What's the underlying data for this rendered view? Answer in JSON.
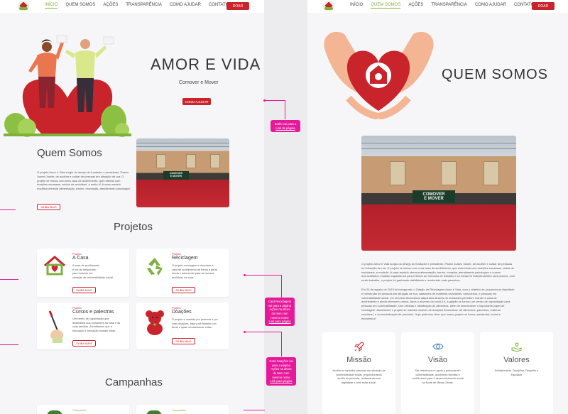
{
  "nav": {
    "items": [
      "INÍCIO",
      "QUEM SOMOS",
      "AÇÕES",
      "TRANSPARÊNCIA",
      "COMO AJUDAR",
      "CONTATO"
    ],
    "donate_label": "DOAR"
  },
  "home": {
    "hero_title": "AMOR E VIDA",
    "hero_subtitle": "Comover e Mover",
    "hero_button": "COMO AJUDAR",
    "about_title": "Quem Somos",
    "about_lines": [
      "O projeto Amor e Vida surgiu do desejo do fundador e presidente, Pastor",
      "Juarez Xavier, de acolher e cuidar de pessoas em situação de rua. O",
      "projeto se iniciou com uma casa de acolhimento, que rebe­bia com",
      "doações escassas, cuidou de reciclável, a muito N. A casa modelo",
      "modifica oferecia alimentação, banho, recreação, atendimento psicológico"
    ],
    "about_button": "SAIBA MAIS",
    "projects_title": "Projetos",
    "projects": [
      {
        "kicker": "Projeto",
        "title": "A Casa",
        "lines": [
          "A casa de acolhimento",
          "é um lar temporário",
          "para homens em",
          "situação de vulnerabilidade social."
        ],
        "button": "SAIBA MAIS"
      },
      {
        "kicker": "Projeto",
        "title": "Reciclagem",
        "lines": [
          "O projeto reciclagem é vinculado à",
          "casa de acolhimento de forma a gerar",
          "renda e autonomia para os homens",
          "acolhidos na casa."
        ],
        "button": "SAIBA MAIS"
      },
      {
        "kicker": "Projeto",
        "title": "Cursos e palestras",
        "lines": [
          "Um centro de capacitação que",
          "destinados aos moradores da casa e as",
          "suas famílias. Acreditamos que a",
          "educação e formação mudam vidas."
        ],
        "button": "SAIBA MAIS"
      },
      {
        "kicker": "Projeto",
        "title": "Doações",
        "lines": [
          "O projeto é mantido por pessoas e por",
          "suas doações, seja você também um",
          "fiscal e ajude a transformar vidas."
        ],
        "button": "SAIBA MAIS"
      }
    ],
    "campaigns_title": "Campanhas",
    "campaign_kicker": "Campanha"
  },
  "annotations": {
    "note1": [
      "Botão vai para a",
      "Link da página"
    ],
    "note2": [
      "Card Reciclagem",
      "vai para a página",
      "Ações na altura",
      "do Item com",
      "mesmo nome",
      "Link para página"
    ],
    "note3": [
      "Card Doações vai",
      "para a página",
      "Ações na altura",
      "do Item com",
      "mesmo nome",
      "Link para página"
    ]
  },
  "about": {
    "title": "QUEM SOMOS",
    "photo_sign": [
      "COMOVER",
      "E MOVER"
    ],
    "paragraph1": [
      "O projeto Amor e Vida surgiu do desejo do fundador e presidente, Pastor Juarez Xavier, de acolher e cuidar de pessoas",
      "em situação de rua. O projeto se iniciou com uma casa de acolhimento, que sobrevivia com doações escassas, coleta de",
      "recicláveis, e muita fé. A casa modelo oferecia alimentação, banho, moradia, atendimento psicológico e cursos",
      "aos acolhidos, visando capacitá-los para retomar ao mercado de trabalho e se tornarem independentes. Aos poucos, com",
      "muito trabalho, o projeto foi ganhando visibilidade e recebendo mais parceiros."
    ],
    "paragraph2": [
      "Em 24 de agosto de 2019 foi inaugurado o Galpão de Reciclagem Amor e Vida, com o objetivo de proporcionar dignidade",
      "e reinserção de pessoas em situação de rua, catadores de materiais recicláveis, carroceiros, e pessoas em",
      "vulnerabilidade social. Os recursos financeiros adquiridos através do reciclados permitem manter a casa de",
      "acolhimento e ainda oferecem cursos. Após o advento do covid-19, a galpão se tornou um centro de capacitação para",
      "pessoas em vulnerabilidade, com oficinas e distribuição de alimentos, além de desenvolver o importante papel de",
      "reciclagem. Atualmente o projeto se mantém através de doações financeiras, de alimentos, parceiros, material",
      "reciclável, e comercialização de produtos. Hoje podemos dizer que nosso projeto se tornou ambiental, social e",
      "econômico!"
    ],
    "features": [
      {
        "title": "Missão",
        "lines": [
          "Acolher e capacitar pessoas em situação de",
          "vulnerabilidade social, proporcionando",
          "auxílio às pessoas, restaurando sua",
          "dignidade e bem estar social."
        ]
      },
      {
        "title": "Visão",
        "lines": [
          "Ser referência no apoio a pessoas em",
          "vulnerabilidade, acolhendo famílias e",
          "contribuindo para o desenvolvimento social",
          "na Norte de Minas Gerais."
        ]
      },
      {
        "title": "Valores",
        "lines": [
          "Solidariedade, Disciplina, Respeito e",
          "Equidade"
        ]
      }
    ]
  },
  "colors": {
    "brand_red": "#c9242b",
    "brand_green": "#7fb03c",
    "annotation_pink": "#e6199a"
  }
}
